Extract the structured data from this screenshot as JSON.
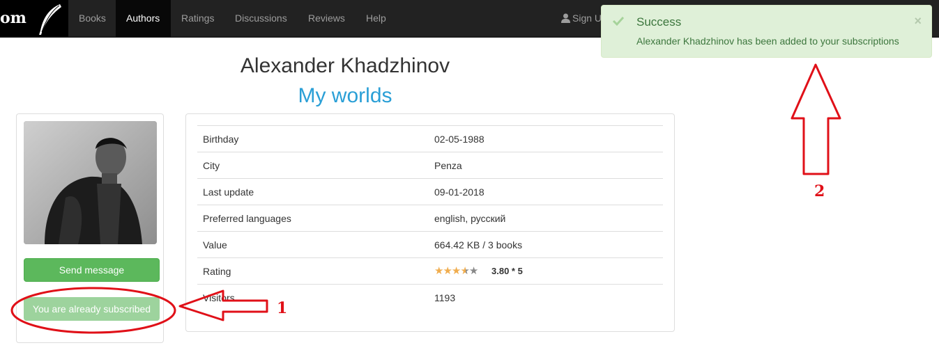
{
  "brand": {
    "text": "om"
  },
  "nav": {
    "items": [
      {
        "label": "Books",
        "active": false
      },
      {
        "label": "Authors",
        "active": true
      },
      {
        "label": "Ratings",
        "active": false
      },
      {
        "label": "Discussions",
        "active": false
      },
      {
        "label": "Reviews",
        "active": false
      },
      {
        "label": "Help",
        "active": false
      }
    ],
    "signin_label": "Sign U"
  },
  "author": {
    "name": "Alexander Khadzhinov",
    "subtitle": "My worlds"
  },
  "actions": {
    "send_message": "Send message",
    "subscribed": "You are already subscribed"
  },
  "info": {
    "rows": [
      {
        "label": "Birthday",
        "value": "02-05-1988"
      },
      {
        "label": "City",
        "value": "Penza"
      },
      {
        "label": "Last update",
        "value": "09-01-2018"
      },
      {
        "label": "Preferred languages",
        "value": "english, русский"
      },
      {
        "label": "Value",
        "value": "664.42 KB / 3 books"
      },
      {
        "label": "Rating",
        "value": ""
      },
      {
        "label": "Visitors",
        "value": "1193"
      }
    ],
    "rating": {
      "text": "3.80 * 5",
      "stars": 3.8,
      "max": 5
    }
  },
  "alert": {
    "title": "Success",
    "message": "Alexander Khadzhinov has been added to your subscriptions",
    "close": "×"
  },
  "annotations": {
    "one": "1",
    "two": "2"
  },
  "colors": {
    "navbar": "#222222",
    "accent_blue": "#2a9fd6",
    "success_green": "#5cb85c",
    "annotation_red": "#e01018"
  }
}
